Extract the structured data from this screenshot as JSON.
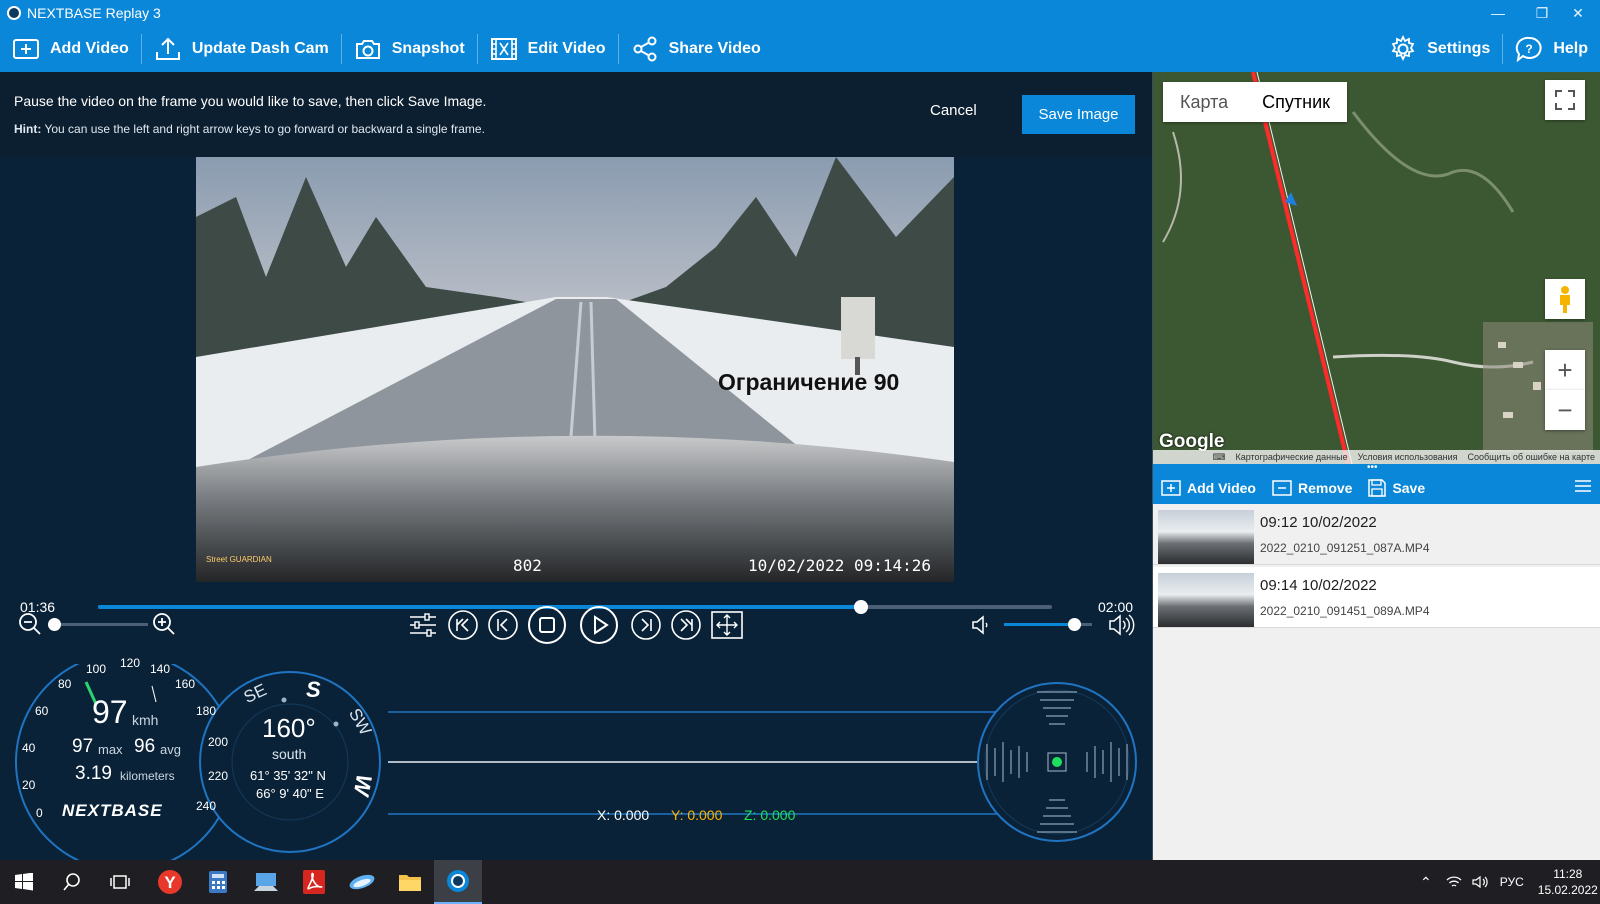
{
  "window": {
    "title": "NEXTBASE Replay 3",
    "minimize": "—",
    "restore": "❐",
    "close": "✕"
  },
  "toolbar": {
    "add_video": "Add Video",
    "update_dash_cam": "Update Dash Cam",
    "snapshot": "Snapshot",
    "edit_video": "Edit Video",
    "share_video": "Share Video",
    "settings": "Settings",
    "help": "Help"
  },
  "snapshot_panel": {
    "instruction": "Pause the video on the frame you would like to save, then click Save Image.",
    "hint_label": "Hint:",
    "hint_text": " You can use the left and right arrow keys to go forward or backward a single frame.",
    "cancel": "Cancel",
    "save_image": "Save Image"
  },
  "video": {
    "overlay_text": "Ограничение 90",
    "frame_number": "802",
    "timestamp": "10/02/2022  09:14:26",
    "logo": "Street GUARDIAN"
  },
  "playback": {
    "current_time": "01:36",
    "total_time": "02:00",
    "progress": 0.8,
    "zoom_level": 0.0,
    "volume": 0.8
  },
  "gauges": {
    "speed": "97",
    "speed_unit": "kmh",
    "max": "97",
    "max_label": "max",
    "avg": "96",
    "avg_label": "avg",
    "distance": "3.19",
    "distance_unit": "kilometers",
    "brand": "NEXTBASE",
    "speed_ticks": [
      "0",
      "20",
      "40",
      "60",
      "80",
      "100",
      "120",
      "140",
      "160",
      "180",
      "200",
      "220",
      "240"
    ],
    "heading": "160°",
    "heading_text": "south",
    "lat": "61° 35' 32\" N",
    "lon": "66° 9' 40\" E",
    "compass_se": "SE",
    "compass_s": "S",
    "compass_sw": "SW",
    "compass_w": "W",
    "accel_x": "X: 0.000",
    "accel_y": "Y: 0.000",
    "accel_z": "Z: 0.000"
  },
  "map": {
    "tab_map": "Карта",
    "tab_satellite": "Спутник",
    "google": "Google",
    "footer_data": "Картографические данные",
    "footer_terms": "Условия использования",
    "footer_report": "Сообщить об ошибке на карте",
    "zoom_in": "+",
    "zoom_out": "−"
  },
  "file_list": {
    "add_video": "Add Video",
    "remove": "Remove",
    "save": "Save",
    "items": [
      {
        "datetime": "09:12 10/02/2022",
        "filename": "2022_0210_091251_087A.MP4"
      },
      {
        "datetime": "09:14 10/02/2022",
        "filename": "2022_0210_091451_089A.MP4"
      }
    ]
  },
  "taskbar": {
    "lang": "РУС",
    "time": "11:28",
    "date": "15.02.2022"
  },
  "colors": {
    "accent": "#0a87d8",
    "panel_bg": "#0a2238",
    "accel_y": "#ffb300",
    "accel_z": "#1ee05c"
  }
}
